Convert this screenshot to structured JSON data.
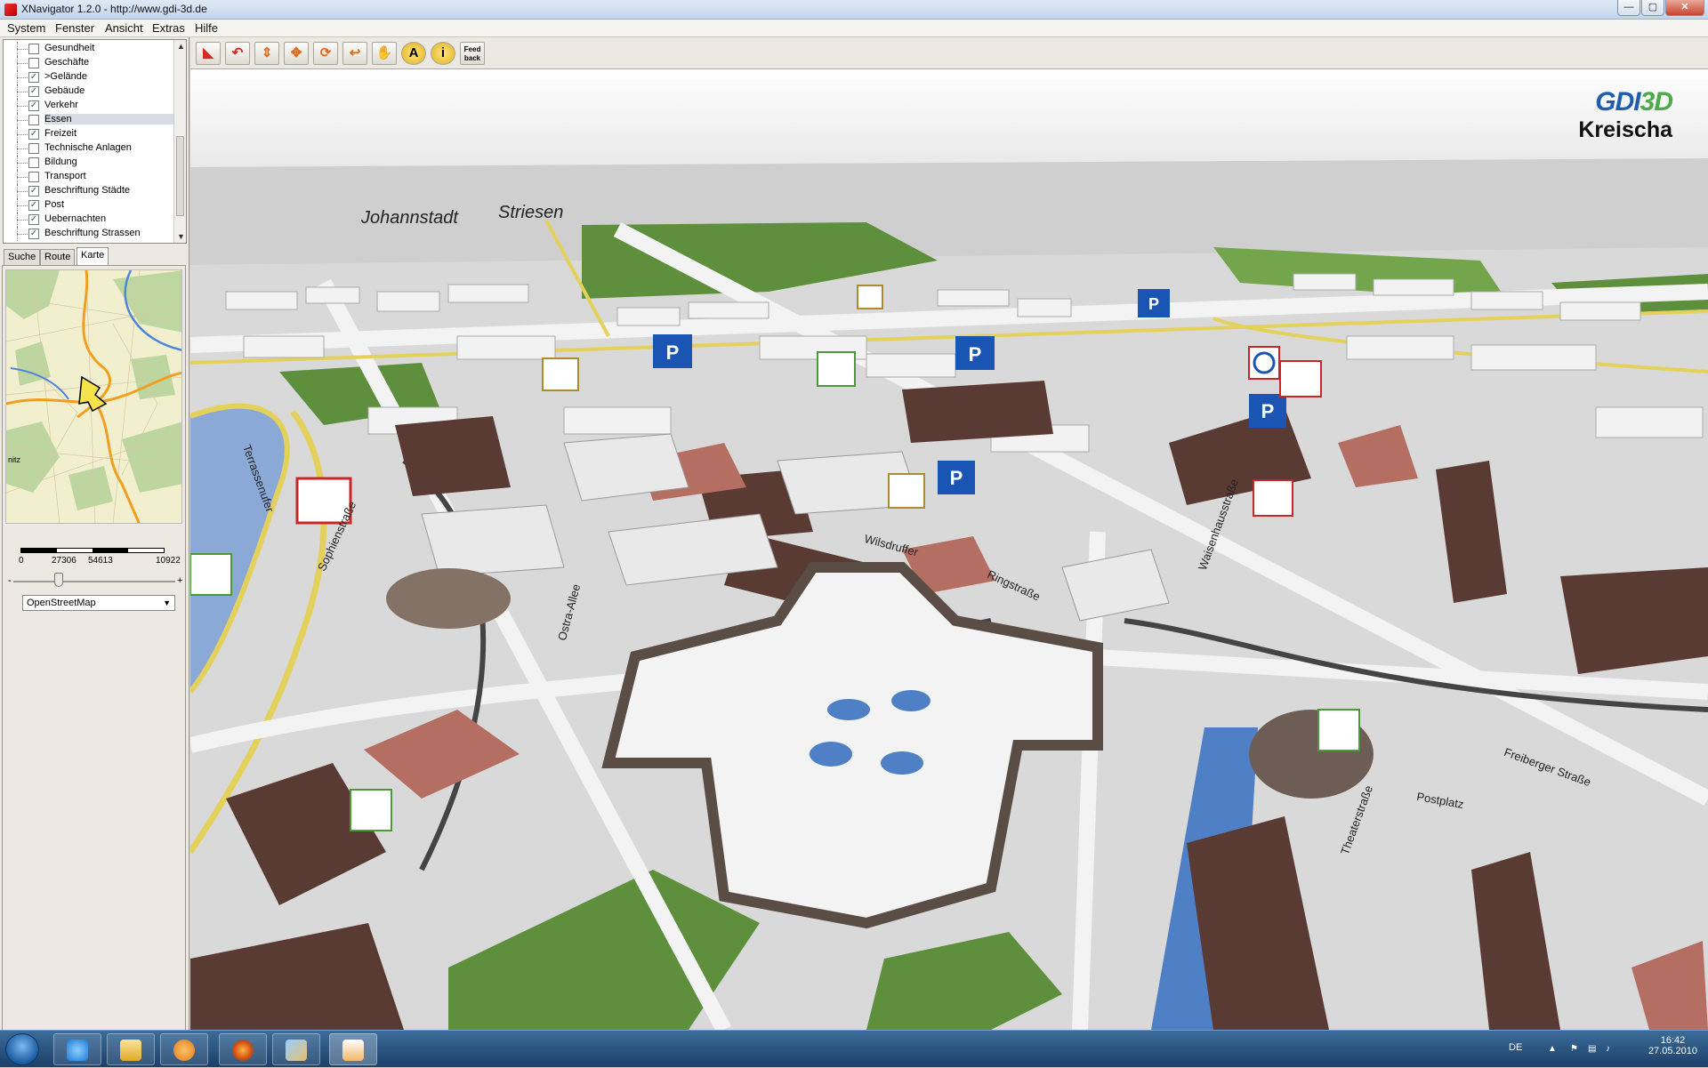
{
  "window": {
    "title": "XNavigator 1.2.0 - http://www.gdi-3d.de",
    "minimize": "—",
    "maximize": "▢",
    "close": "✕"
  },
  "menu": [
    "System",
    "Fenster",
    "Ansicht",
    "Extras",
    "Hilfe"
  ],
  "layers": [
    {
      "label": "Gesundheit",
      "checked": false
    },
    {
      "label": "Geschäfte",
      "checked": false
    },
    {
      "label": ">Gelände",
      "checked": true
    },
    {
      "label": "Gebäude",
      "checked": true
    },
    {
      "label": "Verkehr",
      "checked": true
    },
    {
      "label": "Essen",
      "checked": false,
      "selected": true
    },
    {
      "label": "Freizeit",
      "checked": true
    },
    {
      "label": "Technische Anlagen",
      "checked": false
    },
    {
      "label": "Bildung",
      "checked": false
    },
    {
      "label": "Transport",
      "checked": false
    },
    {
      "label": "Beschriftung Städte",
      "checked": true
    },
    {
      "label": "Post",
      "checked": true
    },
    {
      "label": "Uebernachten",
      "checked": true
    },
    {
      "label": "Beschriftung Strassen",
      "checked": true
    }
  ],
  "tabs": [
    "Suche",
    "Route",
    "Karte"
  ],
  "active_tab": "Karte",
  "minimap": {
    "edge_label": "nitz",
    "scale_labels": [
      "0",
      "27306",
      "54613",
      "10922"
    ]
  },
  "zoom": {
    "minus": "-",
    "plus": "+"
  },
  "map_source": "OpenStreetMap",
  "toolbar": [
    {
      "name": "pan-icon",
      "glyph": "◣"
    },
    {
      "name": "rotate-icon",
      "glyph": "↶"
    },
    {
      "name": "move-updown-icon",
      "glyph": "⇕"
    },
    {
      "name": "move-all-icon",
      "glyph": "✥"
    },
    {
      "name": "orbit-icon",
      "glyph": "⟳"
    },
    {
      "name": "back-icon",
      "glyph": "↩"
    },
    {
      "name": "hand-icon",
      "glyph": "✋"
    },
    {
      "name": "label-icon",
      "glyph": "A"
    },
    {
      "name": "info-icon",
      "glyph": "i"
    },
    {
      "name": "feedback-icon",
      "glyph": "Feed back"
    }
  ],
  "brand": {
    "logo_a": "GDI",
    "logo_b": "3D",
    "town": "Kreischa"
  },
  "districts": [
    "Johannstadt",
    "Striesen"
  ],
  "street_labels": [
    "Terrassenufer",
    "Sophienstraße",
    "Wilsdruffer",
    "Ringstraße",
    "Waisenhausstraße",
    "Freiberger Straße",
    "Postplatz",
    "Theaterstraße",
    "Ostra-Allee"
  ],
  "taskbar": {
    "lang": "DE",
    "time": "16:42",
    "date": "27.05.2010"
  },
  "colors": {
    "water": "#8aa9d6",
    "green": "#5e8f3d",
    "roof_brown": "#5a3b33",
    "road_yellow": "#e3d15c"
  }
}
